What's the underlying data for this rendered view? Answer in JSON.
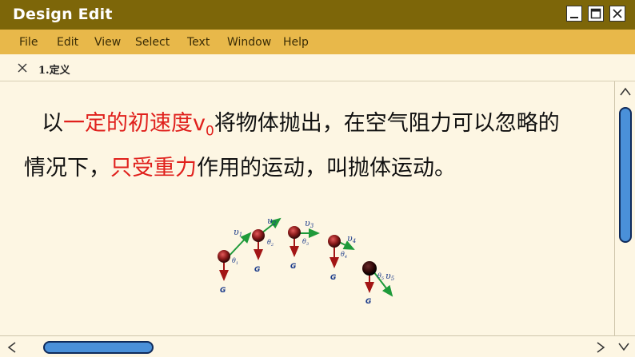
{
  "window": {
    "title": "Design Edit"
  },
  "menu": {
    "items": [
      "File",
      "Edit",
      "View",
      "Select",
      "Text",
      "Window",
      "Help"
    ]
  },
  "tab": {
    "label": "1.定义"
  },
  "paragraph": {
    "line1": {
      "prefix": "以",
      "highlight": "一定的初速度v",
      "subscript": "0",
      "suffix": "将物体抛出，在空气阻力可以忽略的"
    },
    "line2": {
      "prefix": "情况下，",
      "highlight": "只受重力",
      "suffix": "作用的运动，叫抛体运动。"
    }
  },
  "diagram": {
    "velocity_label": "υ",
    "velocity_label_peak": "υ",
    "gravity_label": "G",
    "angle_label": "θ",
    "subscripts": [
      "1",
      "2",
      "3",
      "4",
      "5"
    ]
  },
  "colors": {
    "titlebar": "#7d6609",
    "menubar": "#e8b84a",
    "background": "#fdf6e3",
    "highlight_text": "#e0201c",
    "scroll_thumb": "#4a90d9"
  }
}
